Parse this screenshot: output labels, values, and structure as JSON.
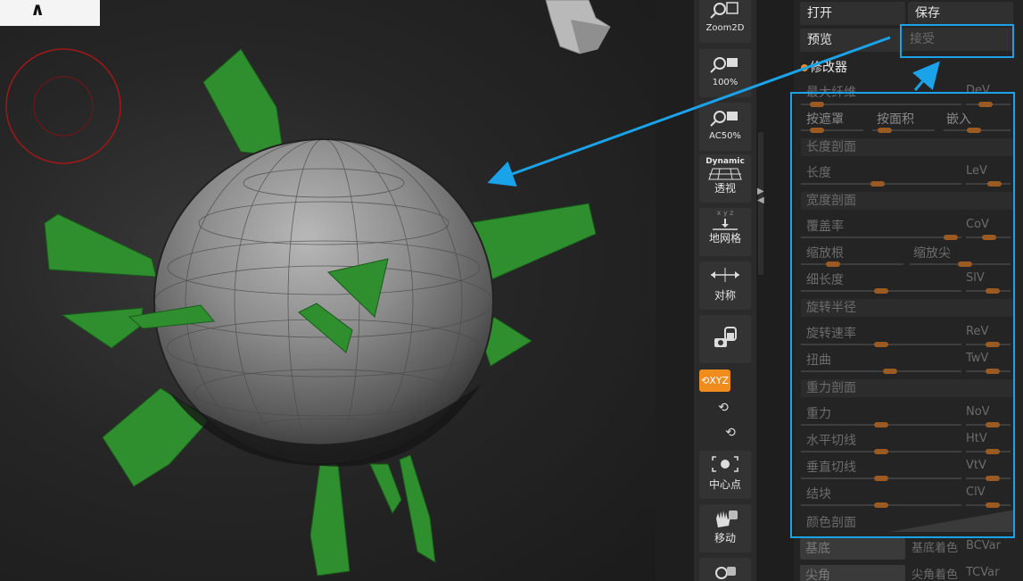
{
  "toolbar": {
    "zoom2d": "Zoom2D",
    "zoom100": "100%",
    "ac50": "AC50%",
    "dynamic": "Dynamic",
    "perspective": "透视",
    "floor": "地网格",
    "symmetry": "对称",
    "xyz": "XYZ",
    "center": "中心点",
    "move": "移动"
  },
  "panel": {
    "open": "打开",
    "save": "保存",
    "preview": "预览",
    "accept": "接受",
    "modifiers": "修改器",
    "max_fibers": "最大纤维",
    "dev": "DeV",
    "by_mask": "按遮罩",
    "by_area": "按面积",
    "embed": "嵌入",
    "length_profile": "长度剖面",
    "length": "长度",
    "lev": "LeV",
    "width_profile": "宽度剖面",
    "coverage": "覆盖率",
    "cov": "CoV",
    "scale_root": "缩放根",
    "scale_tip": "缩放尖",
    "slimness": "细长度",
    "slv": "SlV",
    "revolve_radius": "旋转半径",
    "revolve_rate": "旋转速率",
    "rev": "ReV",
    "twist": "扭曲",
    "twv": "TwV",
    "gravity_profile": "重力剖面",
    "gravity": "重力",
    "nov": "NoV",
    "h_tangent": "水平切线",
    "htv": "HtV",
    "v_tangent": "垂直切线",
    "vtv": "VtV",
    "clump": "结块",
    "clv": "ClV",
    "color_profile": "颜色剖面",
    "base": "基底",
    "base_tint": "基底着色",
    "bcvar": "BCVar",
    "tip": "尖角",
    "tip_tint": "尖角着色",
    "tcvar": "TCVar"
  },
  "colors": {
    "accent_orange": "#f08c1e",
    "highlight_blue": "#1aa3e8",
    "fiber_green": "#2e8a2e",
    "sphere_gray": "#8a8a8a"
  }
}
